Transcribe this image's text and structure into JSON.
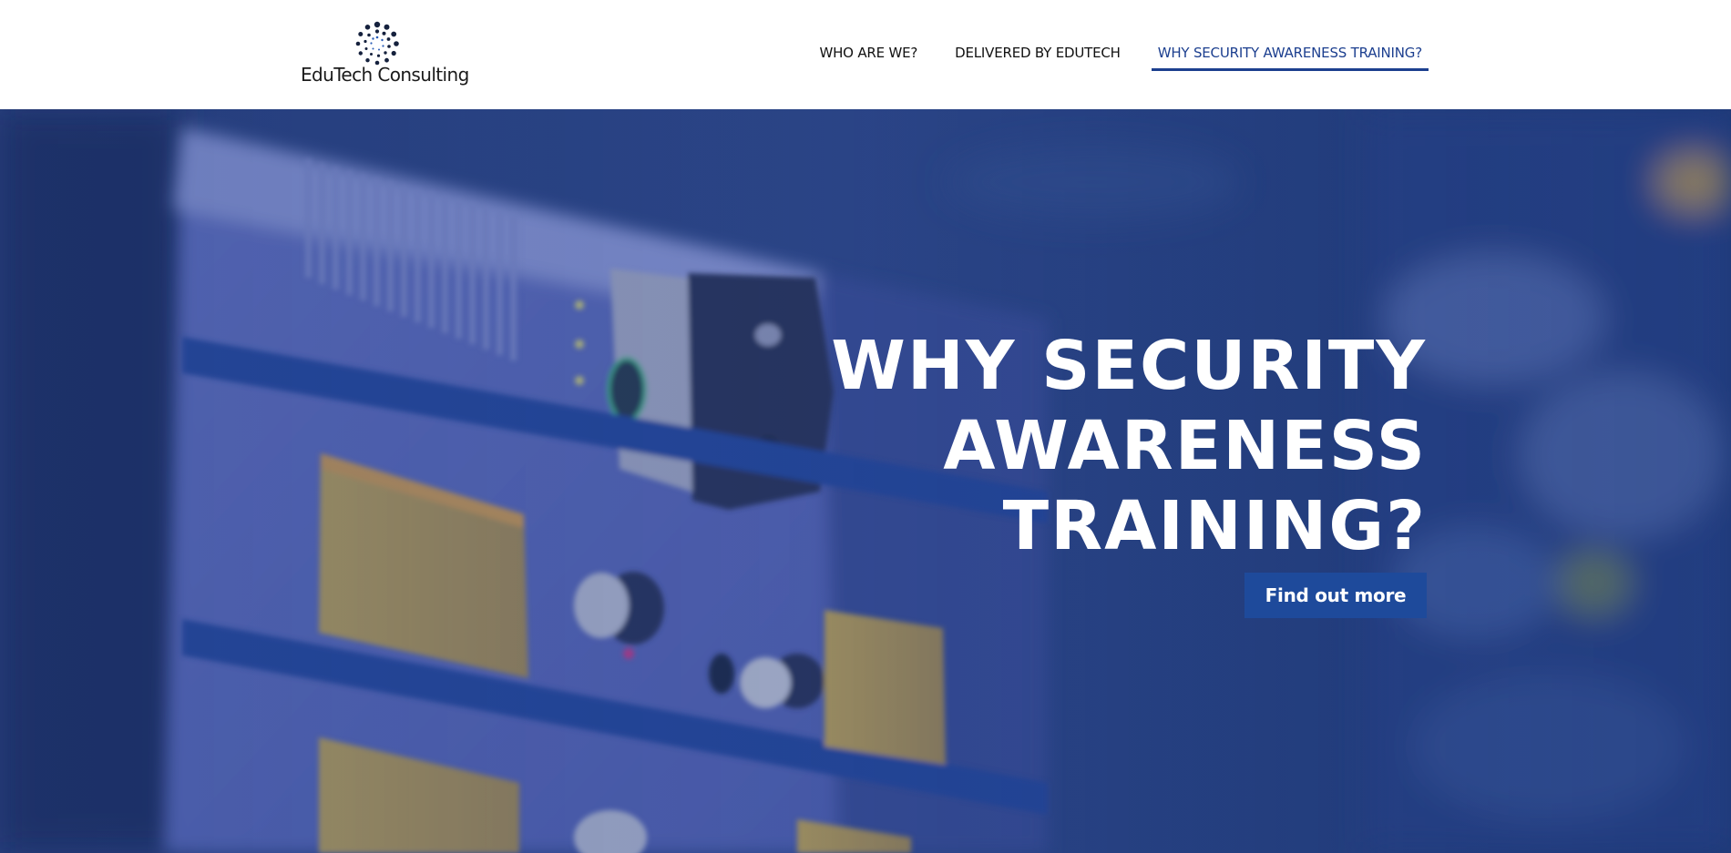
{
  "brand": {
    "name": "EduTech Consulting",
    "logo_icon": "dotted-circle-logo-icon",
    "colors": {
      "primary": "#1c3f8f",
      "button": "#1e4a9b",
      "hero_overlay": "#27417c",
      "text_dark": "#111111"
    }
  },
  "nav": {
    "items": [
      {
        "label": "WHO ARE WE?",
        "active": false
      },
      {
        "label": "DELIVERED BY EDUTECH",
        "active": false
      },
      {
        "label": "WHY SECURITY AWARENESS TRAINING?",
        "active": true
      }
    ]
  },
  "hero": {
    "background": "blurred-server-rack-photo",
    "title_lines": [
      "WHY SECURITY",
      "AWARENESS",
      "TRAINING?"
    ],
    "cta_label": "Find out more"
  }
}
